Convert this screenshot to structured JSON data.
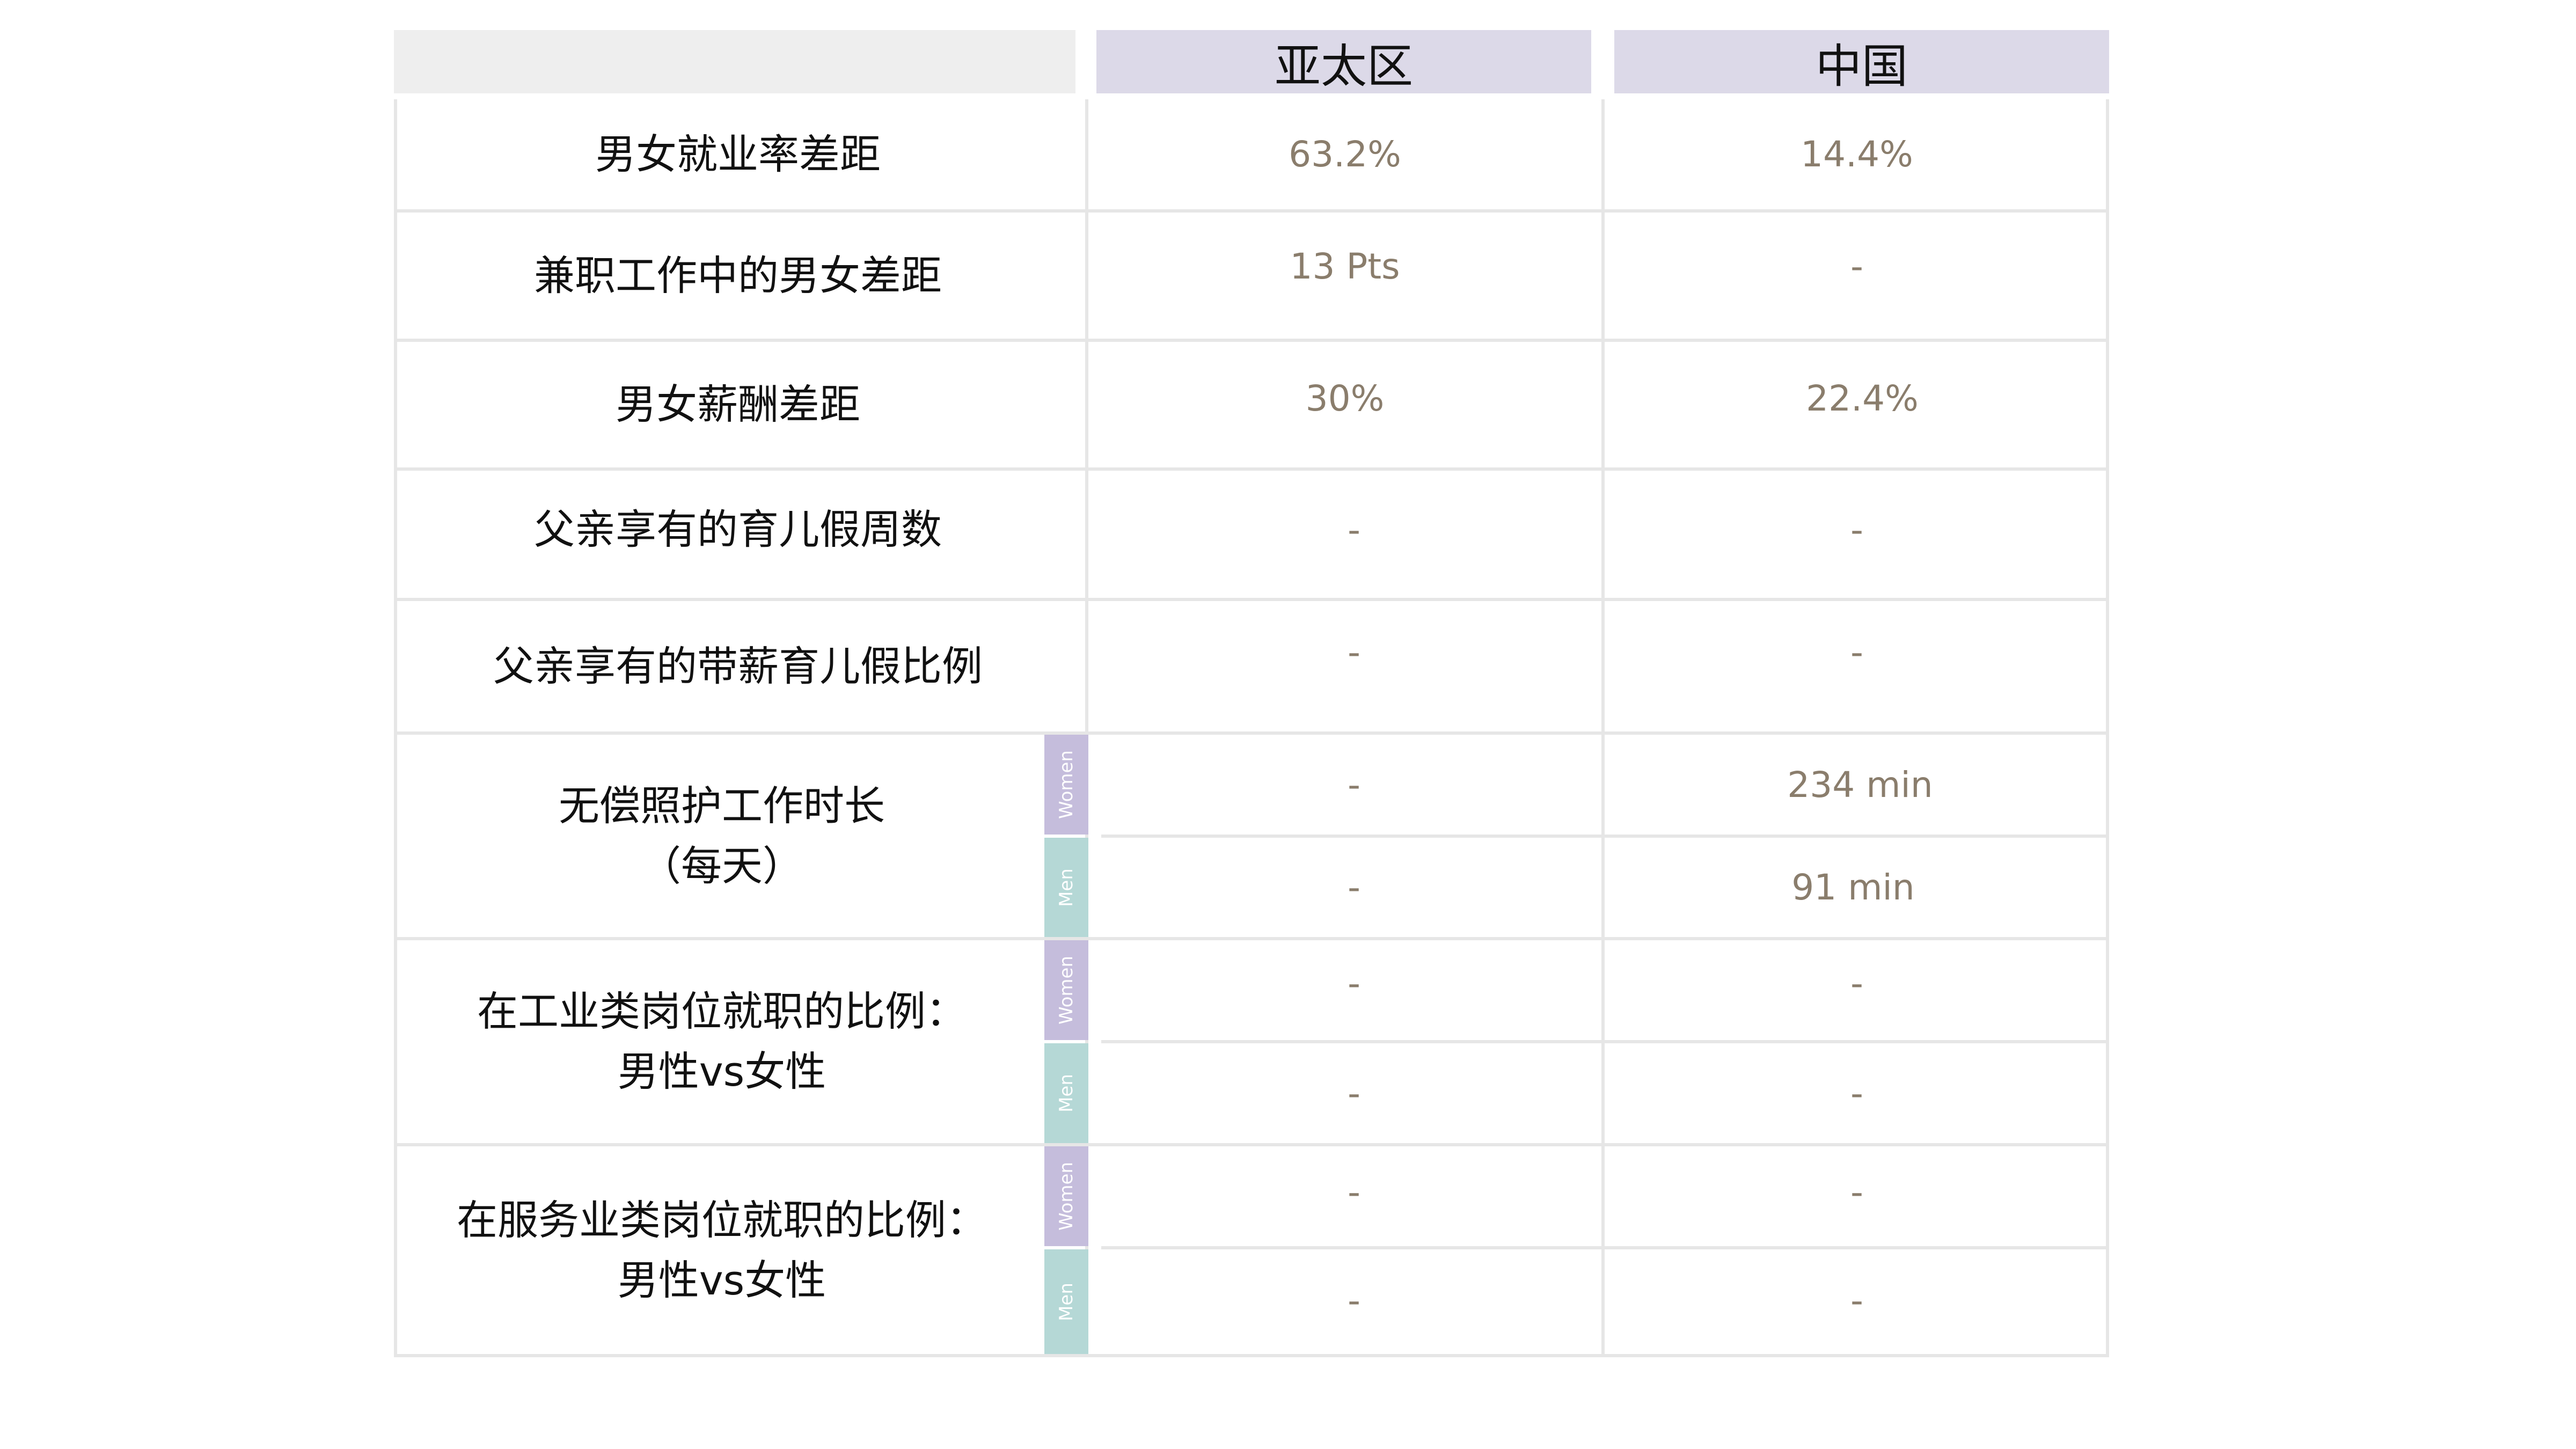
{
  "header": {
    "col_blank": "",
    "col_apac": "亚太区",
    "col_china": "中国"
  },
  "rows": [
    {
      "label": "男女就业率差距",
      "apac": "63.2%",
      "china": "14.4%"
    },
    {
      "label": "兼职工作中的男女差距",
      "apac": "13 Pts",
      "china": "-"
    },
    {
      "label": "男女薪酬差距",
      "apac": "30%",
      "china": "22.4%"
    },
    {
      "label": "父亲享有的育儿假周数",
      "apac": "-",
      "china": "-"
    },
    {
      "label": "父亲享有的带薪育儿假比例",
      "apac": "-",
      "china": "-"
    }
  ],
  "split_rows": [
    {
      "label_line1": "无偿照护工作时长",
      "label_line2": "（每天）",
      "women": {
        "tag": "Women",
        "apac": "-",
        "china": "234 min"
      },
      "men": {
        "tag": "Men",
        "apac": "-",
        "china": "91 min"
      }
    },
    {
      "label_line1": "在工业类岗位就职的比例：",
      "label_line2": "男性vs女性",
      "women": {
        "tag": "Women",
        "apac": "-",
        "china": "-"
      },
      "men": {
        "tag": "Men",
        "apac": "-",
        "china": "-"
      }
    },
    {
      "label_line1": "在服务业类岗位就职的比例：",
      "label_line2": "男性vs女性",
      "women": {
        "tag": "Women",
        "apac": "-",
        "china": "-"
      },
      "men": {
        "tag": "Men",
        "apac": "-",
        "china": "-"
      }
    }
  ],
  "colors": {
    "header_bg": "#dcd9e8",
    "women_tag": "#c5bddc",
    "men_tag": "#b5d8d6",
    "value_text": "#8a7d6c"
  }
}
